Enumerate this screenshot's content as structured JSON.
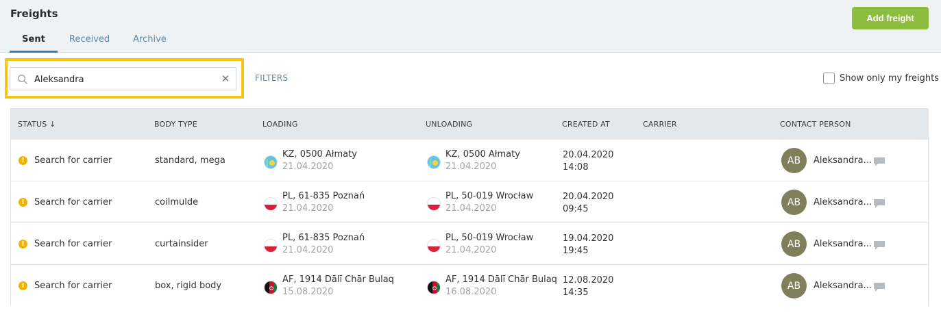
{
  "header": {
    "title": "Freights",
    "add_button": "Add freight",
    "tabs": [
      {
        "label": "Sent",
        "active": true
      },
      {
        "label": "Received",
        "active": false
      },
      {
        "label": "Archive",
        "active": false
      }
    ]
  },
  "search": {
    "value": "Aleksandra",
    "icon": "search-icon",
    "clear_icon": "close-icon"
  },
  "filters_label": "FILTERS",
  "only_mine": {
    "label": "Show only my freights",
    "checked": false
  },
  "columns": {
    "status": "STATUS ↓",
    "body_type": "BODY TYPE",
    "loading": "LOADING",
    "unloading": "UNLOADING",
    "created_at": "CREATED AT",
    "carrier": "CARRIER",
    "contact_person": "CONTACT PERSON"
  },
  "rows": [
    {
      "status": "Search for carrier",
      "body_type": "standard, mega",
      "loading": {
        "flag": "kz",
        "place": "KZ, 0500 Ałmaty",
        "date": "21.04.2020"
      },
      "unloading": {
        "flag": "kz",
        "place": "KZ, 0500 Ałmaty",
        "date": "21.04.2020"
      },
      "created_date": "20.04.2020",
      "created_time": "14:08",
      "carrier": "",
      "avatar": "AB",
      "contact": "Aleksandra..."
    },
    {
      "status": "Search for carrier",
      "body_type": "coilmulde",
      "loading": {
        "flag": "pl",
        "place": "PL, 61-835 Poznań",
        "date": "21.04.2020"
      },
      "unloading": {
        "flag": "pl",
        "place": "PL, 50-019 Wrocław",
        "date": "21.04.2020"
      },
      "created_date": "20.04.2020",
      "created_time": "09:45",
      "carrier": "",
      "avatar": "AB",
      "contact": "Aleksandra..."
    },
    {
      "status": "Search for carrier",
      "body_type": "curtainsider",
      "loading": {
        "flag": "pl",
        "place": "PL, 61-835 Poznań",
        "date": "21.04.2020"
      },
      "unloading": {
        "flag": "pl",
        "place": "PL, 50-019 Wrocław",
        "date": "21.04.2020"
      },
      "created_date": "19.04.2020",
      "created_time": "19:45",
      "carrier": "",
      "avatar": "AB",
      "contact": "Aleksandra..."
    },
    {
      "status": "Search for carrier",
      "body_type": "box, rigid body",
      "loading": {
        "flag": "af",
        "place": "AF, 1914 Dālī Chār Bulaq",
        "date": "15.08.2020"
      },
      "unloading": {
        "flag": "af",
        "place": "AF, 1914 Dālī Chār Bulaq",
        "date": "16.08.2020"
      },
      "created_date": "12.08.2020",
      "created_time": "14:35",
      "carrier": "",
      "avatar": "AB",
      "contact": "Aleksandra..."
    }
  ],
  "colors": {
    "accent_button": "#8dbd3f",
    "tab_active_underline": "#4d7893",
    "link": "#5d87a4",
    "highlight_border": "#f5c518",
    "status_warning": "#f0b400",
    "avatar_bg": "#7f7f5c"
  }
}
